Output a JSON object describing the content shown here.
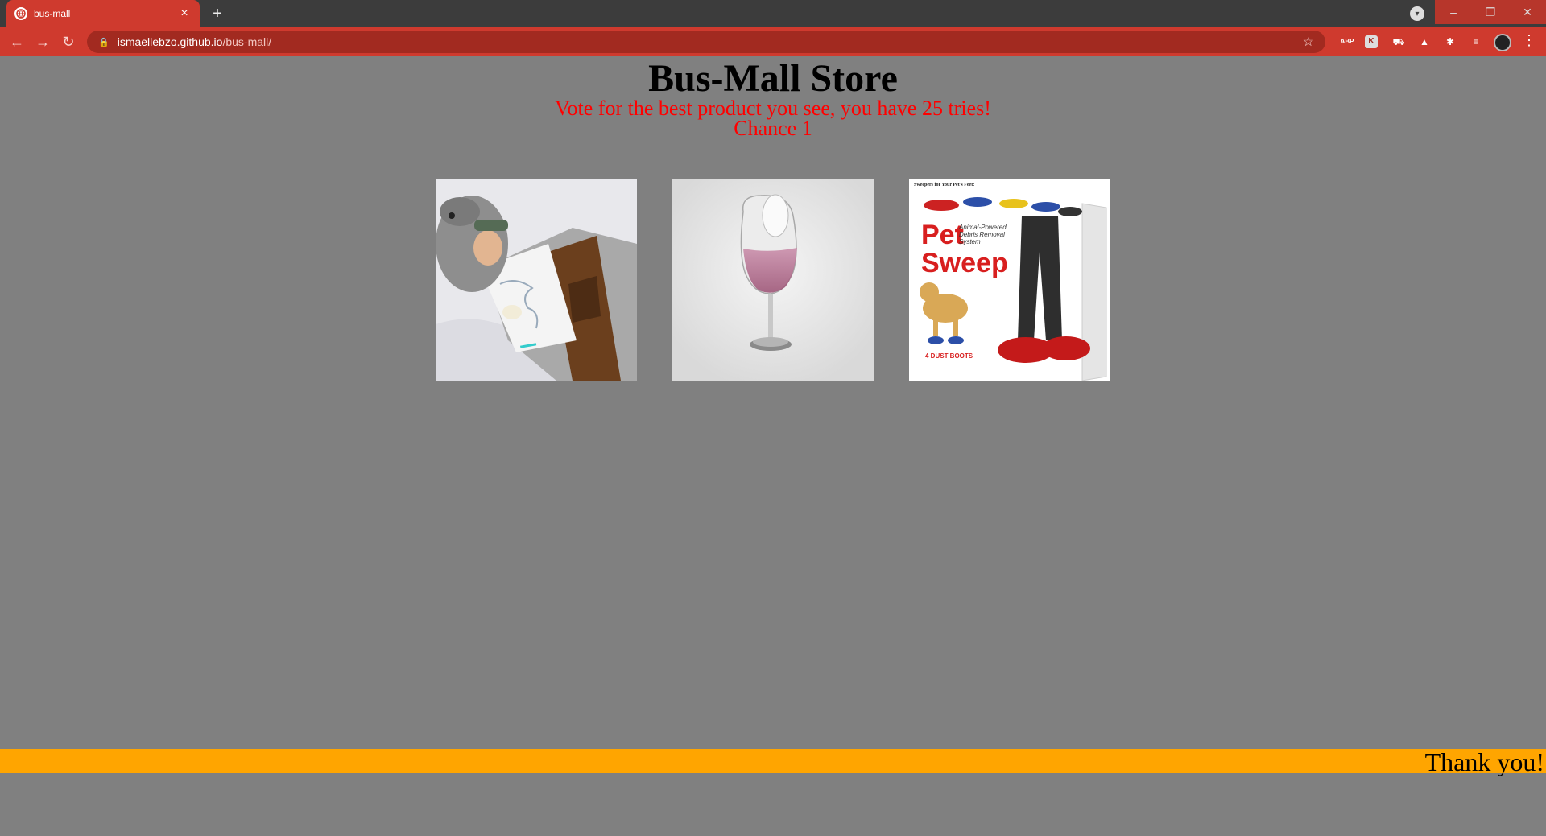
{
  "browser": {
    "tab_title": "bus-mall",
    "tab_close": "×",
    "new_tab": "+",
    "url_host": "ismaellebzo.github.io",
    "url_path": "/bus-mall/",
    "extensions": [
      "ABP",
      "K"
    ],
    "window_controls": {
      "minimize": "–",
      "maximize": "❐",
      "close": "✕"
    },
    "accent_color": "#cf3a2e"
  },
  "page": {
    "title": "Bus-Mall Store",
    "subtitle": "Vote for the best product you see, you have 25 tries!",
    "chance": "Chance 1",
    "products": [
      {
        "name": "tauntaun sleeping bag"
      },
      {
        "name": "wine glass"
      },
      {
        "name": "pet sweep"
      }
    ],
    "pet_sweep_text": {
      "header": "Sweepers for Your Pet's Feet:",
      "brand_line1": "Pet",
      "brand_line2": "Sweep",
      "tagline": "Animal-Powered Debris Removal System",
      "boots": "4 DUST BOOTS"
    },
    "footer_text": "Thank you!",
    "background_color": "#808080",
    "footer_color": "#ffa500",
    "subtitle_color": "#ff0000"
  }
}
